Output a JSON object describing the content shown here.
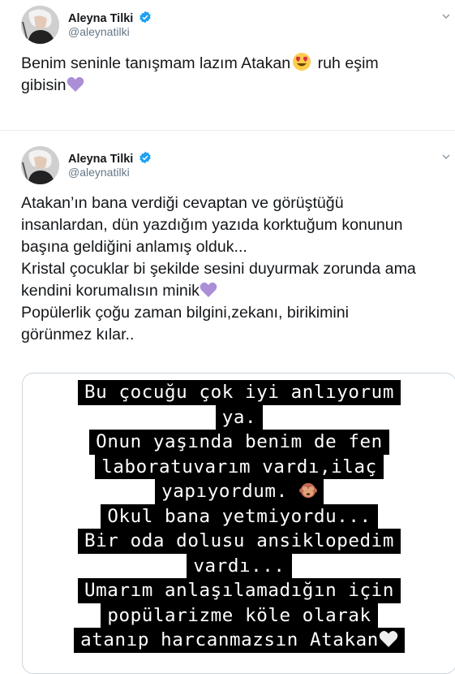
{
  "tweets": [
    {
      "name": "Aleyna Tilki",
      "handle": "@aleynatilki",
      "text_parts": [
        "Benim seninle tanışmam lazım Atakan",
        "ruh eşim\ngibisin"
      ],
      "emoji": [
        "heart-eyes-icon",
        "purple-heart-icon"
      ]
    },
    {
      "name": "Aleyna Tilki",
      "handle": "@aleynatilki",
      "text_a": "Atakan’ın bana verdiği cevaptan ve görüştüğü\ninsanlardan, dün yazdığım yazıda korktuğum konunun\nbaşına geldiğini anlamış olduk...\nKristal çocuklar bi şekilde sesini duyurmak zorunda ama\nkendini korumalısın minik",
      "text_b": "Popülerlik çoğu zaman bilgini,zekanı, birikimini\ngörünmez kılar..",
      "story_lines": [
        "Bu çocuğu çok iyi anlıyorum",
        "ya.",
        "Onun yaşında benim de fen",
        "laboratuvarım vardı,ilaç",
        "yapıyordum.",
        "Okul bana yetmiyordu...",
        "Bir oda dolusu ansiklopedim",
        "vardı...",
        "Umarım anlaşılamadığın için",
        "popülarizme köle olarak",
        "atanıp harcanmazsın Atakan"
      ],
      "emoji": [
        "purple-heart-icon",
        "see-no-evil-monkey-icon",
        "white-heart-icon"
      ]
    }
  ],
  "colors": {
    "verified": "#1da1f2",
    "purple_heart": "#aa8ed6",
    "handle": "#657786"
  }
}
